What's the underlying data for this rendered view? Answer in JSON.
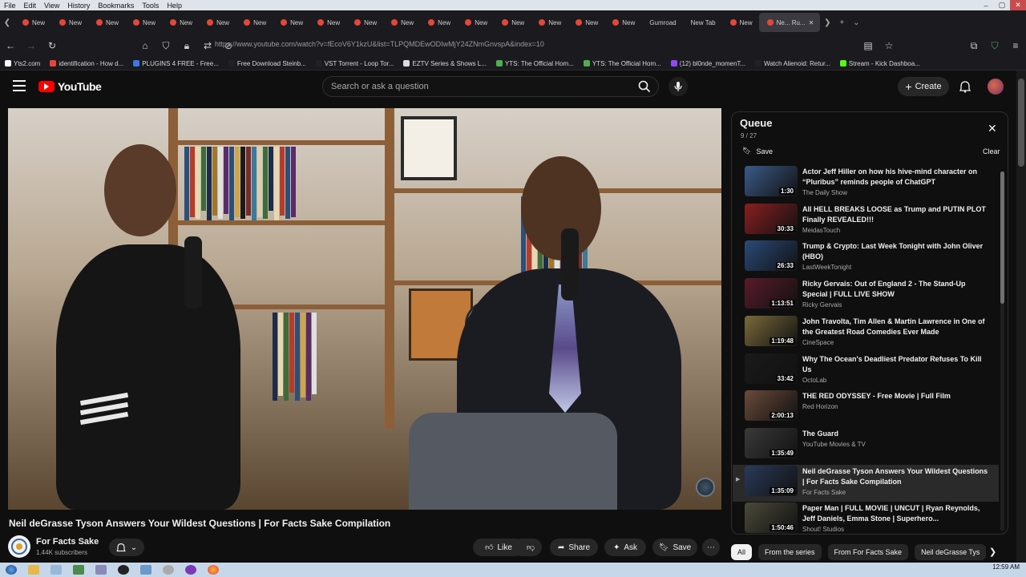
{
  "menubar": {
    "items": [
      "File",
      "Edit",
      "View",
      "History",
      "Bookmarks",
      "Tools",
      "Help"
    ]
  },
  "tabs": {
    "items": [
      "New",
      "New",
      "New",
      "New",
      "New",
      "New",
      "New",
      "New",
      "New",
      "New",
      "New",
      "New",
      "New",
      "New",
      "New",
      "New",
      "New",
      "New",
      "New",
      "Gumroad",
      "New Tab",
      "New"
    ],
    "active_label": "Ne... Ru..."
  },
  "navbar": {
    "url": "https://www.youtube.com/watch?v=fEcoV6Y1kzU&list=TLPQMDEwODIwMjY24ZNmGnvspA&index=10"
  },
  "bookmarks": {
    "items": [
      {
        "label": "Yts2.com",
        "color": "#ffffff"
      },
      {
        "label": "identification - How d...",
        "color": "#e6463a"
      },
      {
        "label": "PLUGINS 4 FREE - Free...",
        "color": "#3a78e6"
      },
      {
        "label": "Free Download Steinb...",
        "color": "#222222"
      },
      {
        "label": "VST Torrent - Loop Tor...",
        "color": "#222222"
      },
      {
        "label": "EZTV Series & Shows L...",
        "color": "#dddddd"
      },
      {
        "label": "YTS: The Official Hom...",
        "color": "#4caf50"
      },
      {
        "label": "YTS: The Official Hom...",
        "color": "#4caf50"
      },
      {
        "label": "(12) bl0nde_momenT...",
        "color": "#9146ff"
      },
      {
        "label": "Watch Alienoid: Retur...",
        "color": "#222222"
      },
      {
        "label": "Stream - Kick Dashboa...",
        "color": "#53fc18"
      }
    ]
  },
  "youtube": {
    "logo_text": "YouTube",
    "search_placeholder": "Search or ask a question",
    "create_label": "Create"
  },
  "video": {
    "title": "Neil deGrasse Tyson Answers Your Wildest Questions | For Facts Sake Compilation",
    "channel": "For Facts Sake",
    "subscribers": "1.44K subscribers",
    "actions": {
      "like": "Like",
      "share": "Share",
      "ask": "Ask",
      "save": "Save"
    }
  },
  "queue": {
    "title": "Queue",
    "count": "9 / 27",
    "save_label": "Save",
    "clear_label": "Clear",
    "items": [
      {
        "title": "Actor Jeff Hiller on how his hive-mind character on “Pluribus” reminds people of ChatGPT",
        "channel": "The Daily Show",
        "duration": "1:30",
        "thumb": "#3b5a8a"
      },
      {
        "title": "All HELL BREAKS LOOSE as Trump and PUTIN PLOT Finally REVEALED!!!",
        "channel": "MeidasTouch",
        "duration": "30:33",
        "thumb": "#8a1f1f"
      },
      {
        "title": "Trump & Crypto: Last Week Tonight with John Oliver (HBO)",
        "channel": "LastWeekTonight",
        "duration": "26:33",
        "thumb": "#2a4a7a"
      },
      {
        "title": "Ricky Gervais: Out of England 2 - The Stand-Up Special | FULL LIVE SHOW",
        "channel": "Ricky Gervais",
        "duration": "1:13:51",
        "thumb": "#5a1a2a"
      },
      {
        "title": "John Travolta, Tim Allen & Martin Lawrence in One of the Greatest Road Comedies Ever Made",
        "channel": "CineSpace",
        "duration": "1:19:48",
        "thumb": "#7a6a3a"
      },
      {
        "title": "Why The Ocean's Deadliest Predator Refuses To Kill Us",
        "channel": "OctoLab",
        "duration": "33:42",
        "thumb": "#1a1a1a"
      },
      {
        "title": "THE RED ODYSSEY - Free Movie | Full Film",
        "channel": "Red Horizon",
        "duration": "2:00:13",
        "thumb": "#6a4a3a"
      },
      {
        "title": "The Guard",
        "channel": "YouTube Movies & TV",
        "duration": "1:35:49",
        "thumb": "#3a3a3a"
      },
      {
        "title": "Neil deGrasse Tyson Answers Your Wildest Questions | For Facts Sake Compilation",
        "channel": "For Facts Sake",
        "duration": "1:35:09",
        "thumb": "#2a3a5a",
        "current": true
      },
      {
        "title": "Paper Man | FULL MOVIE | UNCUT | Ryan Reynolds, Jeff Daniels, Emma Stone | Superhero...",
        "channel": "Shout! Studios",
        "duration": "1:50:46",
        "thumb": "#4a4a3a"
      }
    ]
  },
  "chips": [
    "All",
    "From the series",
    "From For Facts Sake",
    "Neil deGrasse Tys"
  ],
  "taskbar": {
    "time": "12:59 AM"
  }
}
